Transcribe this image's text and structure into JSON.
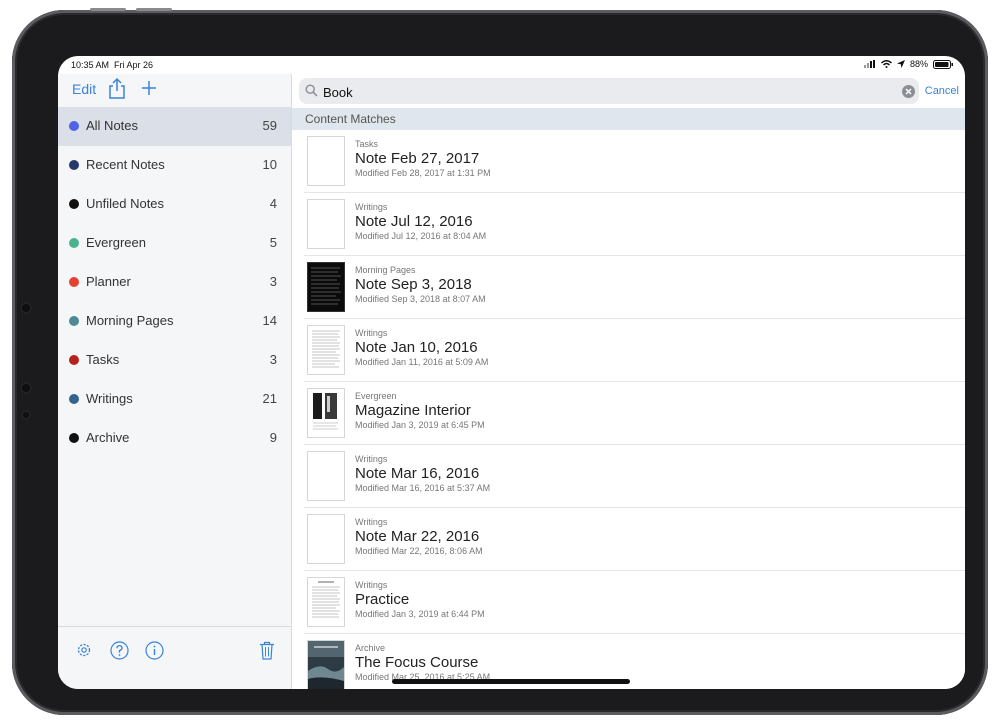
{
  "status": {
    "time": "10:35 AM",
    "date": "Fri Apr 26",
    "battery": "88%"
  },
  "sidebar": {
    "edit_label": "Edit",
    "items": [
      {
        "label": "All Notes",
        "count": "59",
        "color": "#4f63e6",
        "selected": true
      },
      {
        "label": "Recent Notes",
        "count": "10",
        "color": "#25396b"
      },
      {
        "label": "Unfiled Notes",
        "count": "4",
        "color": "#111111"
      },
      {
        "label": "Evergreen",
        "count": "5",
        "color": "#49b38c"
      },
      {
        "label": "Planner",
        "count": "3",
        "color": "#e24330"
      },
      {
        "label": "Morning Pages",
        "count": "14",
        "color": "#4c8b94"
      },
      {
        "label": "Tasks",
        "count": "3",
        "color": "#b8201e"
      },
      {
        "label": "Writings",
        "count": "21",
        "color": "#34638f"
      },
      {
        "label": "Archive",
        "count": "9",
        "color": "#111111"
      }
    ]
  },
  "search": {
    "value": "Book",
    "cancel_label": "Cancel"
  },
  "section_header": "Content Matches",
  "results": [
    {
      "category": "Tasks",
      "title": "Note Feb 27, 2017",
      "modified": "Modified Feb 28, 2017 at 1:31 PM",
      "thumb": "blank"
    },
    {
      "category": "Writings",
      "title": "Note Jul 12, 2016",
      "modified": "Modified Jul 12, 2016 at 8:04 AM",
      "thumb": "blank"
    },
    {
      "category": "Morning Pages",
      "title": "Note Sep 3, 2018",
      "modified": "Modified Sep 3, 2018 at 8:07 AM",
      "thumb": "dark"
    },
    {
      "category": "Writings",
      "title": "Note Jan 10, 2016",
      "modified": "Modified Jan 11, 2016 at 5:09 AM",
      "thumb": "text"
    },
    {
      "category": "Evergreen",
      "title": "Magazine Interior",
      "modified": "Modified Jan 3, 2019 at 6:45 PM",
      "thumb": "magazine"
    },
    {
      "category": "Writings",
      "title": "Note Mar 16, 2016",
      "modified": "Modified Mar 16, 2016 at 5:37 AM",
      "thumb": "blank"
    },
    {
      "category": "Writings",
      "title": "Note Mar 22, 2016",
      "modified": "Modified Mar 22, 2016, 8:06 AM",
      "thumb": "blank"
    },
    {
      "category": "Writings",
      "title": "Practice",
      "modified": "Modified Jan 3, 2019 at 6:44 PM",
      "thumb": "text"
    },
    {
      "category": "Archive",
      "title": "The Focus Course",
      "modified": "Modified Mar 25, 2016 at 5:25 AM",
      "thumb": "photo"
    }
  ],
  "colors": {
    "accent": "#3b82d9",
    "selected_bg": "#dbe0e8",
    "section_bg": "#e0e6ee"
  }
}
